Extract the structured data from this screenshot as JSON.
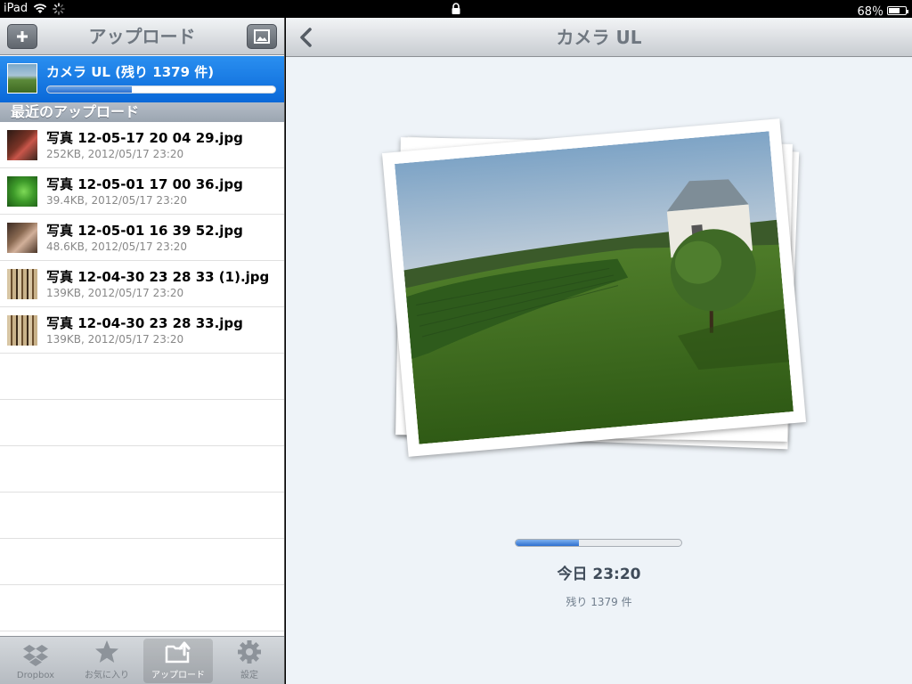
{
  "status_bar": {
    "device": "iPad",
    "battery": "68％",
    "battery_level": 0.68
  },
  "sidebar": {
    "title": "アップロード",
    "current_upload": {
      "label": "カメラ UL (残り 1379 件)",
      "progress": 0.37
    },
    "section_header": "最近のアップロード",
    "files": [
      {
        "name": "写真 12-05-17 20 04 29.jpg",
        "meta": "252KB, 2012/05/17 23:20",
        "thumb": "portrait-red"
      },
      {
        "name": "写真 12-05-01 17 00 36.jpg",
        "meta": "39.4KB, 2012/05/17 23:20",
        "thumb": "green-frog"
      },
      {
        "name": "写真 12-05-01 16 39 52.jpg",
        "meta": "48.6KB, 2012/05/17 23:20",
        "thumb": "portrait-brown"
      },
      {
        "name": "写真 12-04-30 23 28 33 (1).jpg",
        "meta": "139KB, 2012/05/17 23:20",
        "thumb": "books"
      },
      {
        "name": "写真 12-04-30 23 28 33.jpg",
        "meta": "139KB, 2012/05/17 23:20",
        "thumb": "books"
      }
    ],
    "tabs": [
      {
        "label": "Dropbox",
        "icon": "dropbox-icon"
      },
      {
        "label": "お気に入り",
        "icon": "star-icon"
      },
      {
        "label": "アップロード",
        "icon": "upload-icon",
        "active": true
      },
      {
        "label": "設定",
        "icon": "gear-icon"
      }
    ]
  },
  "main": {
    "title": "カメラ UL",
    "progress": 0.38,
    "time": "今日 23:20",
    "remaining": "残り 1379 件"
  }
}
